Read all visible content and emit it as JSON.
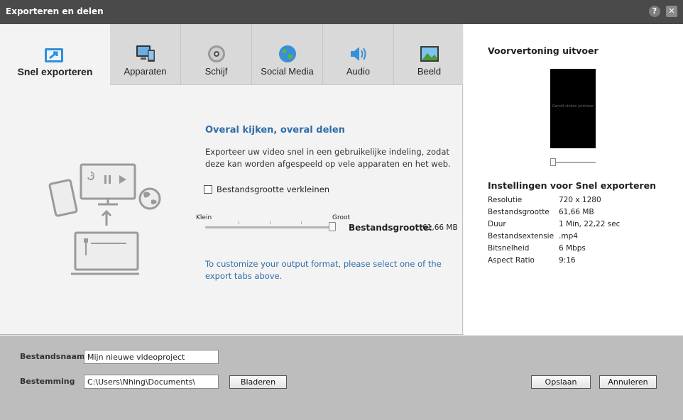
{
  "window": {
    "title": "Exporteren en delen",
    "help_symbol": "?",
    "close_symbol": "✕"
  },
  "tabs": [
    {
      "label": "Snel exporteren",
      "icon": "quick-export-icon",
      "active": true
    },
    {
      "label": "Apparaten",
      "icon": "devices-icon"
    },
    {
      "label": "Schijf",
      "icon": "disc-icon"
    },
    {
      "label": "Social Media",
      "icon": "globe-icon"
    },
    {
      "label": "Audio",
      "icon": "speaker-icon"
    },
    {
      "label": "Beeld",
      "icon": "image-icon"
    }
  ],
  "content": {
    "heading": "Overal kijken, overal delen",
    "description": "Exporteer uw video snel in een gebruikelijke indeling, zodat deze kan worden afgespeeld op vele apparaten en het web.",
    "reduce_size_label": "Bestandsgrootte verkleinen",
    "reduce_size_checked": false,
    "slider_min_label": "Klein",
    "slider_max_label": "Groot",
    "slider_value": 1.0,
    "size_label": "Bestandsgrootte:",
    "size_value": "61,66 MB",
    "hint": "To customize your output format, please select one of the export tabs above."
  },
  "preview": {
    "title": "Voorvertoning uitvoer",
    "screen_text": "Gerald stoken jonkheer",
    "position": 0.0
  },
  "settings": {
    "title": "Instellingen voor Snel exporteren",
    "rows": [
      {
        "key": "Resolutie",
        "value": "720 x 1280"
      },
      {
        "key": "Bestandsgrootte",
        "value": "61,66 MB"
      },
      {
        "key": "Duur",
        "value": "1 Min, 22,22 sec"
      },
      {
        "key": "Bestandsextensie",
        "value": ".mp4"
      },
      {
        "key": "Bitsnelheid",
        "value": "6 Mbps"
      },
      {
        "key": "Aspect Ratio",
        "value": "9:16"
      }
    ]
  },
  "footer": {
    "filename_label": "Bestandsnaam",
    "filename_value": "Mijn nieuwe videoproject",
    "destination_label": "Bestemming",
    "destination_value": "C:\\Users\\Nhing\\Documents\\",
    "browse_label": "Bladeren",
    "save_label": "Opslaan",
    "cancel_label": "Annuleren"
  },
  "colors": {
    "accent": "#2f6da8",
    "titlebar": "#4a4a4a",
    "footer": "#bdbdbd"
  }
}
